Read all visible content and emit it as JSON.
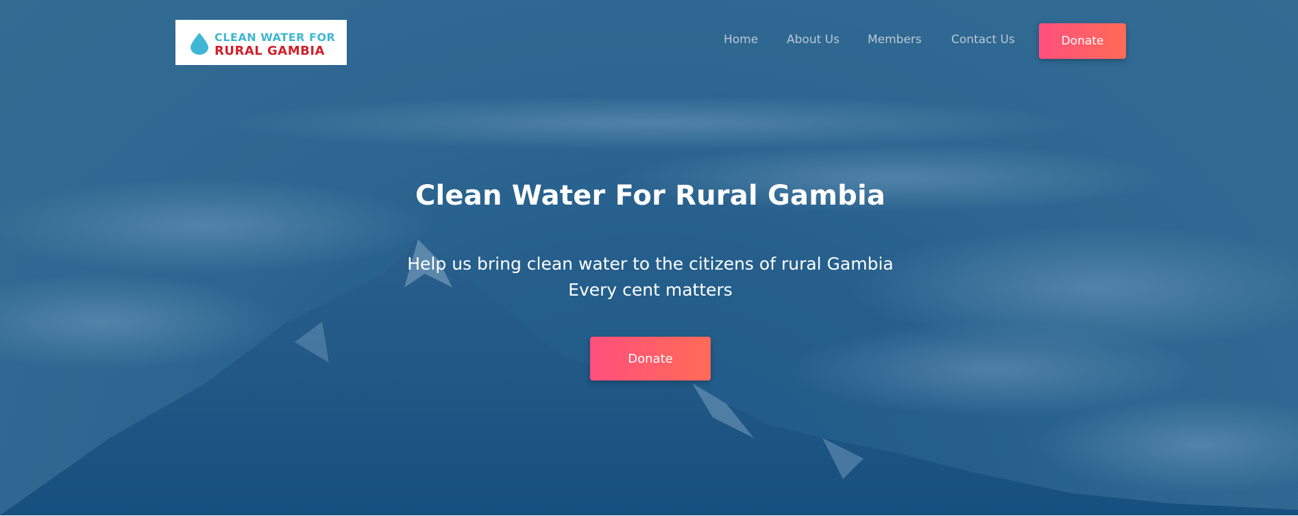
{
  "brand": {
    "logo_line1": "CLEAN WATER FOR",
    "logo_line2": "RURAL GAMBIA",
    "logo_icon": "water-drop-icon"
  },
  "nav": {
    "items": [
      {
        "label": "Home"
      },
      {
        "label": "About Us"
      },
      {
        "label": "Members"
      },
      {
        "label": "Contact Us"
      }
    ],
    "donate_label": "Donate"
  },
  "hero": {
    "title": "Clean Water For Rural Gambia",
    "subtitle_line1": "Help us bring clean water to the citizens of rural Gambia",
    "subtitle_line2": "Every cent matters",
    "donate_label": "Donate",
    "background": "mountains-above-clouds"
  },
  "colors": {
    "overlay": "#2d6791",
    "accent_start": "#ff4f7d",
    "accent_end": "#ff6b56",
    "logo_blue": "#3fb7d2",
    "logo_red": "#d0202a"
  }
}
